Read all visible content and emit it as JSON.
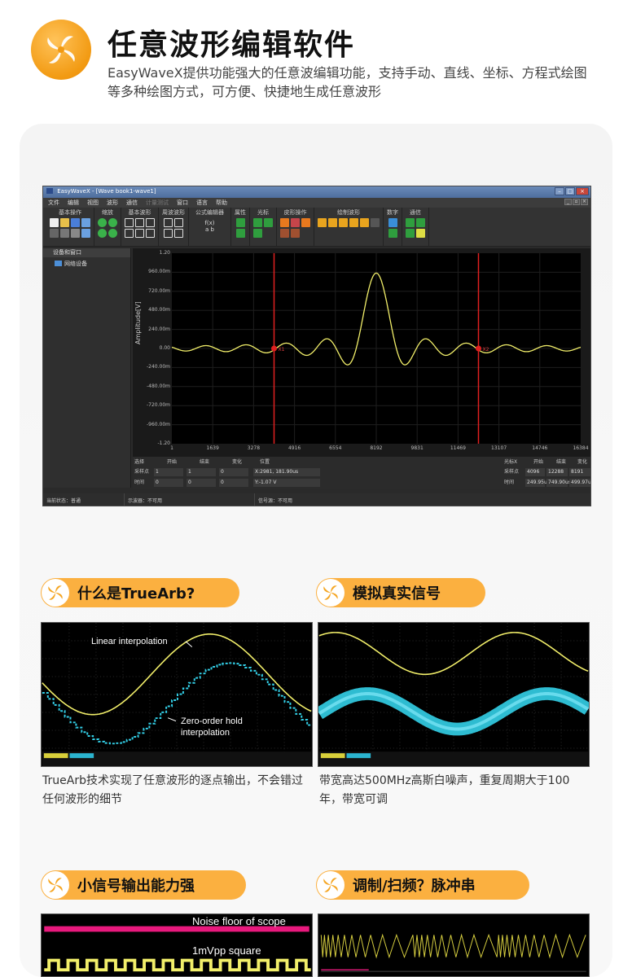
{
  "header": {
    "title": "任意波形编辑软件",
    "description": "EasyWaveX提供功能强大的任意波编辑功能，支持手动、直线、坐标、方程式绘图等多种绘图方式，可方便、快捷地生成任意波形"
  },
  "app": {
    "window_title": "EasyWaveX - [Wave book1-wave1]",
    "menu": [
      "文件",
      "编辑",
      "视图",
      "波形",
      "通信",
      "计量测试",
      "窗口",
      "语言",
      "帮助"
    ],
    "toolbar_groups": [
      "基本操作",
      "缩放",
      "基本波形",
      "周波波形",
      "公式编辑器",
      "属性",
      "光标",
      "皮形操作",
      "绘制波形",
      "数字",
      "通信"
    ],
    "formula_fx": "f(x)",
    "formula_ab": "a b",
    "sidebar": {
      "header": "设备和窗口",
      "item": "网络设备"
    },
    "plot": {
      "ylabel": "Amplitude[V]",
      "yticks": [
        "1.20",
        "960.00m",
        "720.00m",
        "480.00m",
        "240.00m",
        "0.00",
        "-240.00m",
        "-480.00m",
        "-720.00m",
        "-960.00m",
        "-1.20"
      ],
      "xticks": [
        "1",
        "1639",
        "3278",
        "4916",
        "6554",
        "8192",
        "9831",
        "11469",
        "13107",
        "14746",
        "16384"
      ],
      "cursor_labels": [
        "X1",
        "X2"
      ]
    },
    "table_left": {
      "headers": [
        "选择",
        "开始",
        "结束",
        "变化",
        "位置"
      ],
      "rows": [
        {
          "label": "采样点",
          "start": "1",
          "end": "1",
          "delta": "0",
          "pos": "X:2981, 181.90us"
        },
        {
          "label": "时间",
          "start": "0",
          "end": "0",
          "delta": "0",
          "pos": "Y:-1.07 V"
        }
      ]
    },
    "table_right": {
      "headers": [
        "光标X",
        "开始",
        "结束",
        "变化"
      ],
      "rows": [
        {
          "label": "采样点",
          "start": "4096",
          "end": "12288",
          "delta": "8191"
        },
        {
          "label": "时间",
          "start": "249.95us",
          "end": "749.90us",
          "delta": "499.97us"
        }
      ]
    },
    "status": [
      "当前状态：普通",
      "示波器：不可用",
      "信号源：不可用"
    ]
  },
  "sections": [
    {
      "title": "什么是TrueArb?",
      "caption": "TrueArb技术实现了任意波形的逐点输出，不会错过任何波形的细节",
      "labels": [
        "Linear interpolation",
        "Zero-order hold",
        "interpolation"
      ]
    },
    {
      "title": "模拟真实信号",
      "caption": "带宽高达500MHz高斯白噪声，重复周期大于100年，带宽可调",
      "labels": []
    },
    {
      "title": "小信号输出能力强",
      "caption": "",
      "labels": [
        "Noise floor of scope",
        "1mVpp square"
      ]
    },
    {
      "title": "调制/扫频？脉冲串",
      "caption": "",
      "labels": []
    }
  ],
  "colors": {
    "accent": "#fbb040",
    "waveform_yellow": "#f2ef6a",
    "cursor_red": "#e02020",
    "zoh_cyan": "#33d0e8",
    "noise_pink": "#e8197d"
  }
}
